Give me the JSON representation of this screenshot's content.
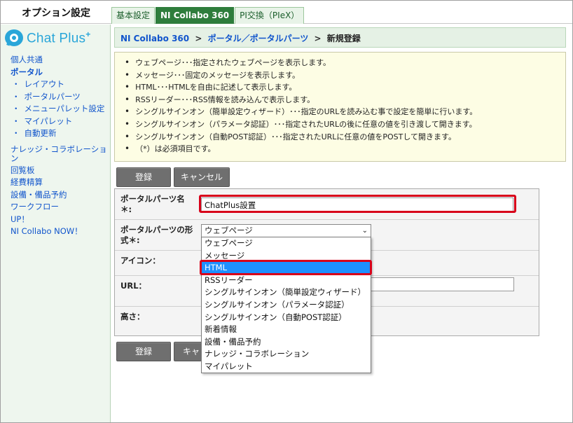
{
  "header": {
    "title": "オプション設定",
    "tabs": [
      {
        "label": "基本設定"
      },
      {
        "label": "NI Collabo 360"
      },
      {
        "label": "PI交換（PIeX）"
      }
    ]
  },
  "sidebar": {
    "logo_text": "Chat Plus",
    "logo_plus": "+",
    "items": [
      {
        "label": "個人共通"
      },
      {
        "label": "ポータル"
      },
      {
        "label": "レイアウト"
      },
      {
        "label": "ポータルパーツ"
      },
      {
        "label": "メニューパレット設定"
      },
      {
        "label": "マイパレット"
      },
      {
        "label": "自動更新"
      },
      {
        "label": "ナレッジ・コラボレーション"
      },
      {
        "label": "回覧板"
      },
      {
        "label": "経費精算"
      },
      {
        "label": "設備・備品予約"
      },
      {
        "label": "ワークフロー"
      },
      {
        "label": "UP！"
      },
      {
        "label": "NI Collabo NOW！"
      }
    ]
  },
  "breadcrumb": {
    "item1": "NI Collabo 360",
    "item2": "ポータル／ポータルパーツ",
    "current": "新規登録",
    "separator": ">"
  },
  "info": [
    "ウェブページ･･･指定されたウェブページを表示します。",
    "メッセージ･･･固定のメッセージを表示します。",
    "HTML･･･HTMLを自由に記述して表示します。",
    "RSSリーダー･･･RSS情報を読み込んで表示します。",
    "シングルサインオン（簡単設定ウィザード）･･･指定のURLを読み込む事で設定を簡単に行います。",
    "シングルサインオン（パラメータ認証）･･･指定されたURLの後に任意の値を引き渡して開きます。",
    "シングルサインオン（自動POST認証）･･･指定されたURLに任意の値をPOSTして開きます。",
    "（*）は必須項目です。"
  ],
  "buttons": {
    "register": "登録",
    "cancel": "キャンセル",
    "cancel_bottom": "キャン"
  },
  "form": {
    "name_label": "ポータルパーツ名\n＊:",
    "name_value": "ChatPlus設置",
    "type_label": "ポータルパーツの形\n式＊:",
    "type_selected": "ウェブページ",
    "icon_label": "アイコン：",
    "url_label": "URL：",
    "height_label": "高さ："
  },
  "dropdown": {
    "options": [
      "ウェブページ",
      "メッセージ",
      "HTML",
      "RSSリーダー",
      "シングルサインオン（簡単設定ウィザード）",
      "シングルサインオン（パラメータ認証）",
      "シングルサインオン（自動POST認証）",
      "新着情報",
      "設備・備品予約",
      "ナレッジ・コラボレーション",
      "マイパレット"
    ],
    "highlighted": "HTML"
  },
  "colors": {
    "accent_green": "#2e7d3c",
    "link_blue": "#1155cc",
    "highlight_red": "#d8001a",
    "selection_blue": "#1e90ff"
  }
}
